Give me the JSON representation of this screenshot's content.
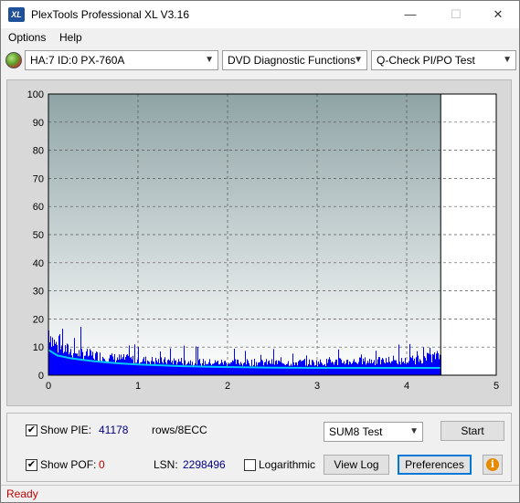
{
  "window": {
    "title": "PlexTools Professional XL V3.16",
    "icon_text": "XL",
    "minimize_glyph": "—",
    "maximize_glyph": "☐",
    "close_glyph": "✕"
  },
  "menu": {
    "options": "Options",
    "help": "Help"
  },
  "toolbar": {
    "drive": "HA:7 ID:0  PX-760A",
    "function": "DVD Diagnostic Functions",
    "test": "Q-Check PI/PO Test"
  },
  "chart_data": {
    "type": "bar",
    "xlim": [
      0,
      5
    ],
    "ylim": [
      0,
      100
    ],
    "x_ticks": [
      "0",
      "1",
      "2",
      "3",
      "4",
      "5"
    ],
    "y_ticks": [
      "0",
      "10",
      "20",
      "30",
      "40",
      "50",
      "60",
      "70",
      "80",
      "90",
      "100"
    ],
    "data_end_x": 4.38,
    "series": [
      {
        "name": "PIE",
        "color": "#0000ff",
        "x": [
          0.0,
          0.05,
          0.1,
          0.2,
          0.3,
          0.5,
          0.75,
          1.0,
          1.25,
          1.5,
          1.75,
          2.0,
          2.5,
          3.0,
          3.5,
          4.0,
          4.2,
          4.38
        ],
        "values": [
          16,
          12,
          10,
          9,
          8,
          7,
          6,
          5.5,
          5,
          5,
          4.5,
          4.5,
          4.5,
          4.5,
          5,
          5,
          6,
          7
        ]
      },
      {
        "name": "PIE average",
        "color": "#00c8ff",
        "x": [
          0.0,
          0.1,
          0.25,
          0.5,
          0.75,
          1.0,
          1.5,
          2.0,
          2.5,
          3.0,
          3.5,
          4.0,
          4.38
        ],
        "values": [
          9,
          7,
          6,
          5,
          4.3,
          3.8,
          3.2,
          2.9,
          2.7,
          2.6,
          2.6,
          2.6,
          2.6
        ]
      }
    ],
    "grid": true,
    "plot_bg_top": "#8fa4a6",
    "plot_bg_bottom": "#ffffff"
  },
  "summary": {
    "show_pie_label": "Show PIE:",
    "pie_value": "41178",
    "rows_label": "rows/8ECC",
    "show_pof_label": "Show POF:",
    "pof_value": "0",
    "lsn_label": "LSN:",
    "lsn_value": "2298496",
    "log_label": "Logarithmic",
    "test_select": "SUM8 Test",
    "start": "Start",
    "view_log": "View Log",
    "preferences": "Preferences",
    "info_glyph": "i",
    "show_pie_checked": true,
    "show_pof_checked": true,
    "log_checked": false
  },
  "status": {
    "text": "Ready"
  }
}
